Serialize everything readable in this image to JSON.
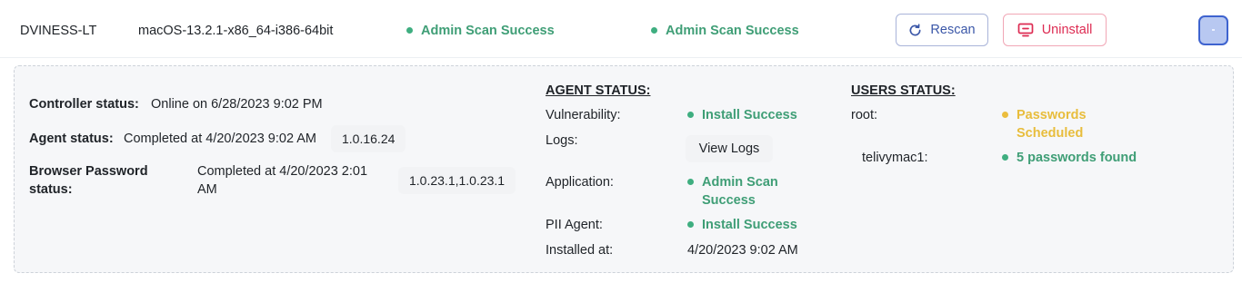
{
  "row": {
    "hostname": "DVINESS-LT",
    "os": "macOS-13.2.1-x86_64-i386-64bit",
    "scan_status_1": "Admin Scan Success",
    "scan_status_2": "Admin Scan Success",
    "rescan_label": "Rescan",
    "uninstall_label": "Uninstall"
  },
  "details": {
    "controller_label": "Controller status:",
    "controller_value": "Online on 6/28/2023 9:02 PM",
    "agent_label": "Agent status:",
    "agent_value": "Completed at 4/20/2023 9:02 AM",
    "agent_version": "1.0.16.24",
    "browser_label_line1": "Browser Password",
    "browser_label_line2": "status:",
    "browser_value_line1": "Completed at 4/20/2023 2:01",
    "browser_value_line2": "AM",
    "browser_version": "1.0.23.1,1.0.23.1"
  },
  "agent_status": {
    "heading": "AGENT STATUS:",
    "vulnerability_label": "Vulnerability:",
    "vulnerability_value": "Install Success",
    "logs_label": "Logs:",
    "view_logs_label": "View Logs",
    "application_label": "Application:",
    "application_value_line1": "Admin Scan",
    "application_value_line2": "Success",
    "pii_label": "PII Agent:",
    "pii_value": "Install Success",
    "installed_label": "Installed at:",
    "installed_value": "4/20/2023 9:02 AM"
  },
  "users_status": {
    "heading": "USERS STATUS:",
    "user1_name": "root:",
    "user1_status_line1": "Passwords",
    "user1_status_line2": "Scheduled",
    "user2_name": "telivymac1:",
    "user2_status": "5 passwords found"
  },
  "colors": {
    "success": "#3f9e76",
    "warning": "#e8bd3c",
    "danger": "#dd2b52",
    "primary": "#3b57a8"
  },
  "icons": {
    "rescan": "refresh-icon",
    "uninstall": "monitor-remove-icon",
    "expand": "collapse-toggle"
  }
}
